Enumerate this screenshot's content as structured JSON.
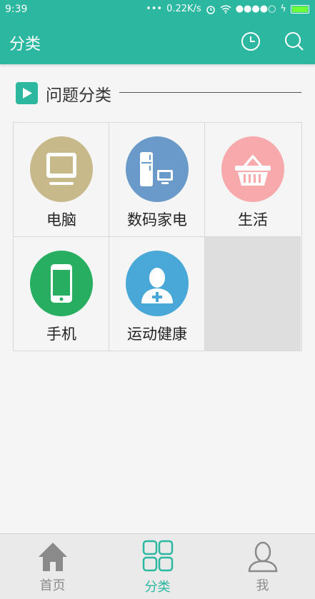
{
  "status_bar": {
    "time": "9:39",
    "net_speed": "0.22K/s",
    "signal": "●●●●○"
  },
  "app_bar": {
    "title": "分类",
    "actions": [
      "history-icon",
      "search-icon"
    ]
  },
  "section": {
    "title": "问题分类"
  },
  "categories": [
    {
      "label": "电脑",
      "icon": "computer-icon",
      "color": "#c8b98a"
    },
    {
      "label": "数码家电",
      "icon": "appliance-icon",
      "color": "#6a9ac9"
    },
    {
      "label": "生活",
      "icon": "basket-icon",
      "color": "#f7a9ab"
    },
    {
      "label": "手机",
      "icon": "phone-icon",
      "color": "#27ae60"
    },
    {
      "label": "运动健康",
      "icon": "health-icon",
      "color": "#4aa8d8"
    }
  ],
  "tab_bar": {
    "tabs": [
      {
        "label": "首页",
        "icon": "home-icon",
        "active": false
      },
      {
        "label": "分类",
        "icon": "grid-icon",
        "active": true
      },
      {
        "label": "我",
        "icon": "user-icon",
        "active": false
      }
    ]
  },
  "colors": {
    "primary": "#2cb7a0",
    "background": "#f5f5f5",
    "tab_inactive": "#8a8a8a"
  }
}
